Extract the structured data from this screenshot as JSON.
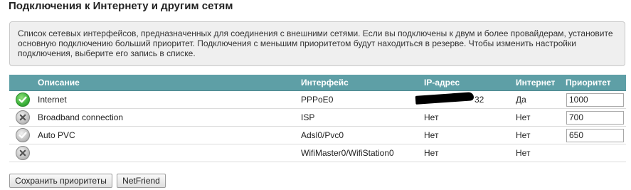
{
  "page": {
    "title": "Подключения к Интернету и другим сетям",
    "info_text": "Список сетевых интерфейсов, предназначенных для соединения с внешними сетями. Если вы подключены к двум и более провайдерам, установите основную подключению больший приоритет. Подключения с меньшим приоритетом будут находиться в резерве. Чтобы изменить настройки подключения, выберите его запись в списке."
  },
  "table": {
    "headers": {
      "description": "Описание",
      "interface": "Интерфейс",
      "ip": "IP-адрес",
      "internet": "Интернет",
      "priority": "Приоритет"
    },
    "rows": [
      {
        "status": "connected",
        "status_icon": "check-circle-icon",
        "description": "Internet",
        "interface": "PPPoE0",
        "ip": "32",
        "internet": "Да",
        "priority": "1000"
      },
      {
        "status": "disconnected",
        "status_icon": "x-circle-icon",
        "description": "Broadband connection",
        "interface": "ISP",
        "ip": "Нет",
        "internet": "Нет",
        "priority": "700"
      },
      {
        "status": "disabled",
        "status_icon": "check-circle-icon",
        "description": "Auto PVC",
        "interface": "Adsl0/Pvc0",
        "ip": "Нет",
        "internet": "Нет",
        "priority": "650"
      },
      {
        "status": "disconnected",
        "status_icon": "x-circle-icon",
        "description": "",
        "interface": "WifiMaster0/WifiStation0",
        "ip": "Нет",
        "internet": "Нет",
        "priority": ""
      }
    ]
  },
  "buttons": {
    "save": "Сохранить приоритеты",
    "netfriend": "NetFriend"
  },
  "colors": {
    "header_bg": "#5e9fa6",
    "ok_green": "#3cb23b",
    "off_gray": "#bdbdbd"
  }
}
